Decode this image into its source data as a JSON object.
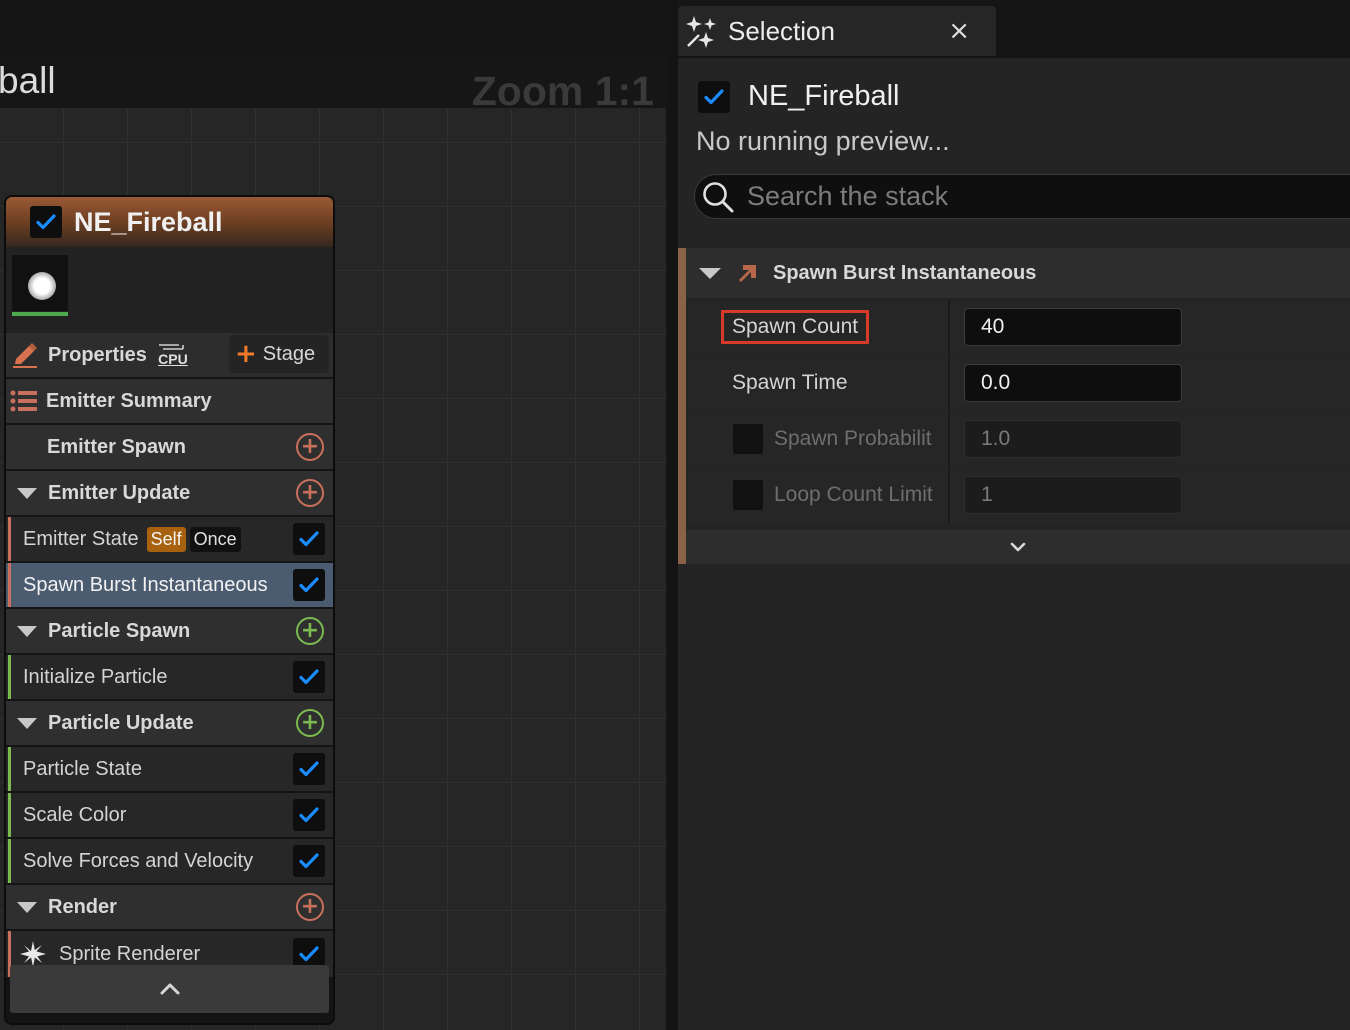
{
  "graph": {
    "title": "ball",
    "zoom_label": "Zoom 1:1"
  },
  "node": {
    "title": "NE_Fireball",
    "enabled": true,
    "properties_label": "Properties",
    "cpu_badge": "CPU",
    "stage_label": "Stage",
    "summary_label": "Emitter Summary",
    "rows": [
      {
        "kind": "section",
        "label": "Emitter Spawn",
        "collapsible": false,
        "add_color": "#c9705c"
      },
      {
        "kind": "section",
        "label": "Emitter Update",
        "collapsible": true,
        "add_color": "#c9705c"
      },
      {
        "kind": "module",
        "label": "Emitter State",
        "tags": [
          "Self",
          "Once"
        ],
        "checked": true,
        "stripe": "#c9705c"
      },
      {
        "kind": "module",
        "label": "Spawn Burst Instantaneous",
        "checked": true,
        "selected": true,
        "stripe": "#c9705c"
      },
      {
        "kind": "section",
        "label": "Particle Spawn",
        "collapsible": true,
        "add_color": "#7aba4e"
      },
      {
        "kind": "module",
        "label": "Initialize Particle",
        "checked": true,
        "stripe": "#7aba4e"
      },
      {
        "kind": "section",
        "label": "Particle Update",
        "collapsible": true,
        "add_color": "#7aba4e"
      },
      {
        "kind": "module",
        "label": "Particle State",
        "checked": true,
        "stripe": "#7aba4e"
      },
      {
        "kind": "module",
        "label": "Scale Color",
        "checked": true,
        "stripe": "#7aba4e"
      },
      {
        "kind": "module",
        "label": "Solve Forces and Velocity",
        "checked": true,
        "stripe": "#7aba4e"
      },
      {
        "kind": "section",
        "label": "Render",
        "collapsible": true,
        "add_color": "#c9705c"
      },
      {
        "kind": "module",
        "label": "Sprite Renderer",
        "checked": true,
        "stripe": "#c9705c",
        "icon": "sprite-icon"
      }
    ],
    "tags": {
      "self": "Self",
      "once": "Once"
    },
    "labels": {
      "emitter_spawn": "Emitter Spawn",
      "emitter_update": "Emitter Update",
      "emitter_state": "Emitter State",
      "spawn_burst": "Spawn Burst Instantaneous",
      "particle_spawn": "Particle Spawn",
      "initialize_particle": "Initialize Particle",
      "particle_update": "Particle Update",
      "particle_state": "Particle State",
      "scale_color": "Scale Color",
      "solve_forces": "Solve Forces and Velocity",
      "render": "Render",
      "sprite_renderer": "Sprite Renderer"
    }
  },
  "selection": {
    "tab_title": "Selection",
    "close_glyph": "×",
    "emitter_name": "NE_Fireball",
    "emitter_enabled": true,
    "status": "No running preview...",
    "search_placeholder": "Search the stack",
    "module_title": "Spawn Burst Instantaneous",
    "properties": [
      {
        "name": "Spawn Count",
        "value": "40",
        "highlighted": true
      },
      {
        "name": "Spawn Time",
        "value": "0.0"
      },
      {
        "name": "Spawn Probabilit",
        "value": "1.0",
        "has_checkbox": true,
        "checked": false
      },
      {
        "name": "Loop Count Limit",
        "value": "1",
        "has_checkbox": true,
        "checked": false
      }
    ]
  },
  "colors": {
    "accent_blue": "#1a8cff",
    "highlight_red": "#d83a2a",
    "stage_orange": "#f07a2a",
    "add_red": "#c9705c",
    "add_green": "#7aba4e"
  }
}
